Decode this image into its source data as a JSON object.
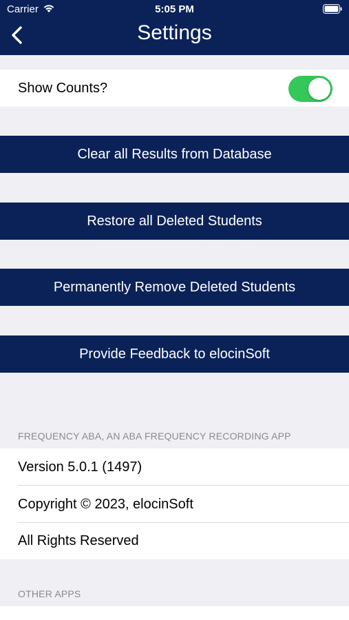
{
  "status_bar": {
    "carrier": "Carrier",
    "time": "5:05 PM"
  },
  "nav": {
    "title": "Settings",
    "back_icon": "chevron-left-icon"
  },
  "settings": {
    "show_counts_label": "Show Counts?",
    "show_counts_on": true,
    "toggle_color": "#34c759"
  },
  "actions": {
    "clear_results": "Clear all Results from Database",
    "restore_students": "Restore all Deleted Students",
    "remove_students": "Permanently Remove Deleted Students",
    "feedback": "Provide Feedback to elocinSoft"
  },
  "about": {
    "header": "FREQUENCY ABA, AN ABA FREQUENCY RECORDING APP",
    "version": "Version 5.0.1 (1497)",
    "copyright": "Copyright © 2023, elocinSoft",
    "rights": "All Rights Reserved"
  },
  "other_apps": {
    "header": "OTHER APPS"
  },
  "colors": {
    "brand": "#0b2259",
    "background": "#efeff4"
  }
}
